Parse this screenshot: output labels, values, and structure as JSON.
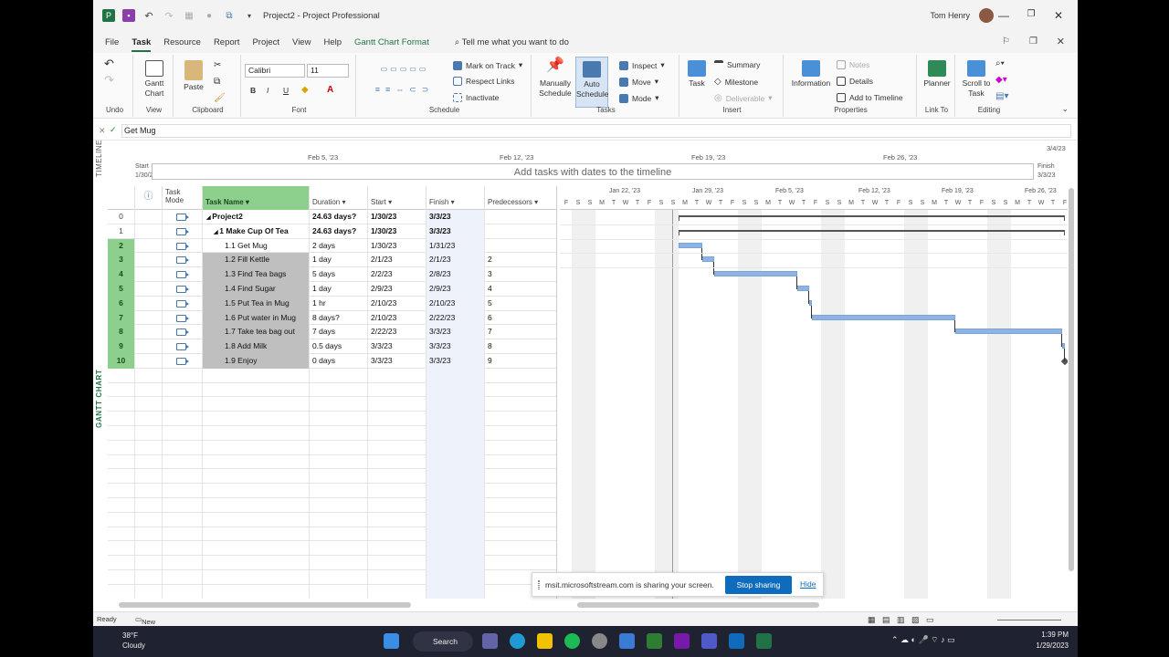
{
  "titlebar": {
    "file_name": "Project2",
    "app_name": "Project Professional",
    "user_name": "Tom Henry"
  },
  "menu": {
    "tabs": [
      "File",
      "Task",
      "Resource",
      "Report",
      "Project",
      "View",
      "Help",
      "Gantt Chart Format"
    ],
    "active_tab": "Task",
    "tell_me": "Tell me what you want to do"
  },
  "ribbon": {
    "undo_group": "Undo",
    "view_group": "View",
    "gantt_chart_btn": "Gantt Chart",
    "clipboard_group": "Clipboard",
    "paste_btn": "Paste",
    "font_group": "Font",
    "font_name": "Calibri",
    "font_size": "11",
    "schedule_group": "Schedule",
    "mark_on_track": "Mark on Track",
    "respect_links": "Respect Links",
    "inactivate": "Inactivate",
    "tasks_group": "Tasks",
    "manually_schedule": "Manually Schedule",
    "auto_schedule": "Auto Schedule",
    "inspect": "Inspect",
    "move": "Move",
    "mode": "Mode",
    "insert_group": "Insert",
    "task_btn": "Task",
    "summary": "Summary",
    "milestone": "Milestone",
    "deliverable": "Deliverable",
    "properties_group": "Properties",
    "information": "Information",
    "notes": "Notes",
    "details": "Details",
    "add_to_timeline": "Add to Timeline",
    "linkto_group": "Link To",
    "planner": "Planner",
    "editing_group": "Editing",
    "scroll_to_task": "Scroll to Task"
  },
  "formula_bar": {
    "value": "Get Mug"
  },
  "timeline": {
    "side_label": "TIMELINE",
    "placeholder": "Add tasks with dates to the timeline",
    "start_label": "Start",
    "start_date": "1/30/23",
    "finish_label": "Finish",
    "finish_date": "3/3/23",
    "dates": [
      "Feb 5, '23",
      "Feb 12, '23",
      "Feb 19, '23",
      "Feb 26, '23",
      "3/4/23"
    ]
  },
  "gantt_side_label": "GANTT CHART",
  "table": {
    "headers": {
      "info": "ⓘ",
      "mode": "Task Mode",
      "name": "Task Name",
      "duration": "Duration",
      "start": "Start",
      "finish": "Finish",
      "predecessors": "Predecessors"
    },
    "rows": [
      {
        "id": "0",
        "name": "Project2",
        "duration": "24.63 days?",
        "start": "1/30/23",
        "finish": "3/3/23",
        "pred": "",
        "summary": true
      },
      {
        "id": "1",
        "name": "1 Make Cup Of Tea",
        "duration": "24.63 days?",
        "start": "1/30/23",
        "finish": "3/3/23",
        "pred": "",
        "summary": true
      },
      {
        "id": "2",
        "name": "1.1 Get Mug",
        "duration": "2 days",
        "start": "1/30/23",
        "finish": "1/31/23",
        "pred": ""
      },
      {
        "id": "3",
        "name": "1.2 Fill Kettle",
        "duration": "1 day",
        "start": "2/1/23",
        "finish": "2/1/23",
        "pred": "2"
      },
      {
        "id": "4",
        "name": "1.3 Find Tea bags",
        "duration": "5 days",
        "start": "2/2/23",
        "finish": "2/8/23",
        "pred": "3"
      },
      {
        "id": "5",
        "name": "1.4 Find Sugar",
        "duration": "1 day",
        "start": "2/9/23",
        "finish": "2/9/23",
        "pred": "4"
      },
      {
        "id": "6",
        "name": "1.5 Put Tea in Mug",
        "duration": "1 hr",
        "start": "2/10/23",
        "finish": "2/10/23",
        "pred": "5"
      },
      {
        "id": "7",
        "name": "1.6 Put water in Mug",
        "duration": "8 days?",
        "start": "2/10/23",
        "finish": "2/22/23",
        "pred": "6"
      },
      {
        "id": "8",
        "name": "1.7 Take tea bag out",
        "duration": "7 days",
        "start": "2/22/23",
        "finish": "3/3/23",
        "pred": "7"
      },
      {
        "id": "9",
        "name": "1.8 Add Milk",
        "duration": "0.5 days",
        "start": "3/3/23",
        "finish": "3/3/23",
        "pred": "8"
      },
      {
        "id": "10",
        "name": "1.9 Enjoy",
        "duration": "0 days",
        "start": "3/3/23",
        "finish": "3/3/23",
        "pred": "9"
      }
    ]
  },
  "chart": {
    "weeks": [
      "Jan 22, '23",
      "Jan 29, '23",
      "Feb 5, '23",
      "Feb 12, '23",
      "Feb 19, '23",
      "Feb 26, '23"
    ],
    "day_letters": [
      "F",
      "S",
      "S",
      "M",
      "T",
      "W",
      "T",
      "F",
      "S",
      "S",
      "M",
      "T",
      "W",
      "T",
      "F",
      "S",
      "S",
      "M",
      "T",
      "W",
      "T",
      "F",
      "S",
      "S",
      "M",
      "T",
      "W",
      "T",
      "F",
      "S",
      "S",
      "M",
      "T",
      "W",
      "T",
      "F",
      "S",
      "S",
      "M",
      "T",
      "W",
      "T",
      "F"
    ],
    "bar_color": "#8eb4e3"
  },
  "share_banner": {
    "message": "msit.microsoftstream.com is sharing your screen.",
    "stop_label": "Stop sharing",
    "hide_label": "Hide"
  },
  "status": {
    "ready": "Ready",
    "new_tasks": "New Tasks : Auto Scheduled"
  },
  "taskbar": {
    "temp": "38°F",
    "weather": "Cloudy",
    "search": "Search",
    "time": "1:39 PM",
    "date": "1/29/2023",
    "teams_badge": "8"
  }
}
